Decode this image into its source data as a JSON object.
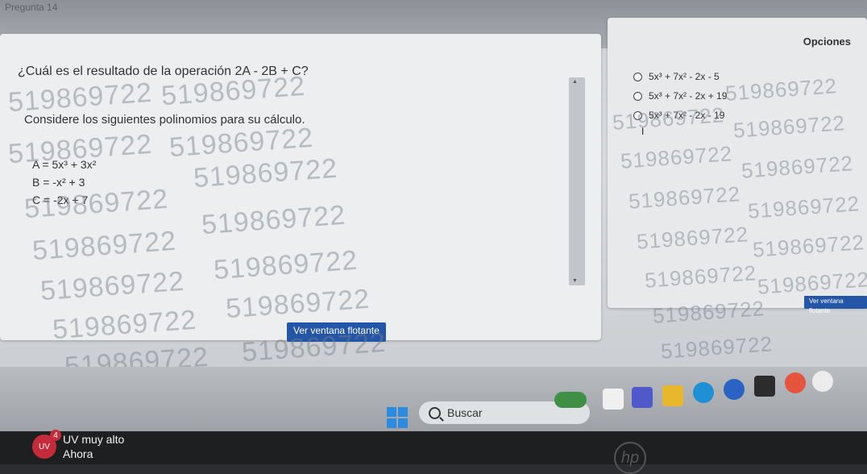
{
  "top_label": "Pregunta 14",
  "question": {
    "text": "¿Cuál es el resultado de la operación 2A - 2B + C?",
    "instruction": "Considere los siguientes polinomios para su cálculo.",
    "polynomials": [
      "A = 5x³ + 3x²",
      "B = -x² + 3",
      "C = -2x + 7"
    ]
  },
  "options": {
    "title": "Opciones",
    "items": [
      "5x³ + 7x² - 2x - 5",
      "5x³ + 7x² - 2x + 19",
      "5x³ + 7x² - 2x - 19"
    ]
  },
  "buttons": {
    "float_main": "Ver ventana flotante",
    "float_small": "Ver ventana flotante"
  },
  "watermark_text": "519869722",
  "taskbar": {
    "search_label": "Buscar",
    "weather_title": "UV muy alto",
    "weather_sub": "Ahora",
    "uv_label": "UV",
    "uv_count": "4"
  },
  "brand": "hp",
  "colors": {
    "accent": "#2356a6",
    "uv_red": "#c52b3a",
    "win_blue": "#2a8be0"
  }
}
